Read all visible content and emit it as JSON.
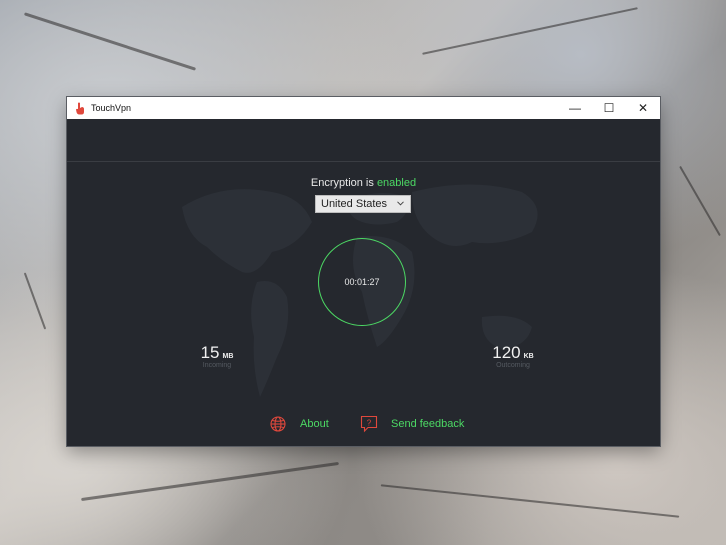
{
  "window": {
    "title": "TouchVpn",
    "controls": {
      "minimize": "—",
      "maximize": "☐",
      "close": "✕"
    }
  },
  "status": {
    "prefix": "Encryption is ",
    "state": "enabled"
  },
  "country_select": {
    "selected": "United States"
  },
  "timer": {
    "elapsed": "00:01:27"
  },
  "stats": {
    "incoming": {
      "value": "15",
      "unit": "MB",
      "label": "Incoming"
    },
    "outgoing": {
      "value": "120",
      "unit": "KB",
      "label": "Outcoming"
    }
  },
  "footer": {
    "about_label": "About",
    "feedback_label": "Send feedback",
    "feedback_icon_glyph": "?"
  },
  "colors": {
    "accent_green": "#4cd964",
    "icon_red": "#e0483c",
    "panel_bg": "#25282e"
  }
}
